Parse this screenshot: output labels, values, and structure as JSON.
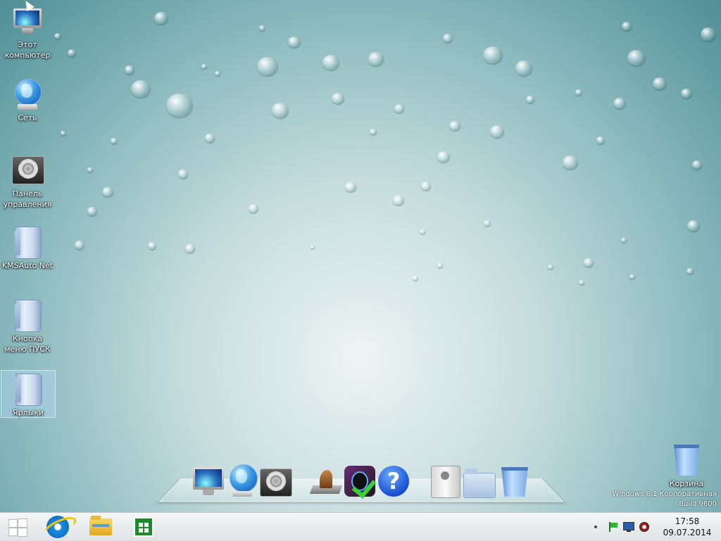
{
  "desktop": {
    "icons": [
      {
        "label": "Этот компьютер",
        "icon": "monitor-icon"
      },
      {
        "label": "Сеть",
        "icon": "globe-network-icon"
      },
      {
        "label": "Панель управления",
        "icon": "control-panel-gear-icon"
      },
      {
        "label": "KMSAuto Net",
        "icon": "folder-icon"
      },
      {
        "label": "Кнопка меню ПУСК",
        "icon": "folder-icon"
      },
      {
        "label": "Ярлыки",
        "icon": "folder-icon"
      }
    ],
    "recycle_bin": {
      "label": "Корзина",
      "icon": "recycle-bin-icon"
    },
    "watermark": {
      "line1": "Windows 8.1 Корпоративная",
      "line2": "Build 9600"
    }
  },
  "dock": {
    "items": [
      "monitor-icon",
      "globe-network-icon",
      "system-preferences-gear-icon",
      "chess-knight-icon",
      "apple-checkmark-icon",
      "help-question-icon",
      "hard-drive-icon",
      "documents-folder-icon",
      "recycle-bin-icon"
    ]
  },
  "taskbar": {
    "buttons": [
      "windows-start-icon",
      "internet-explorer-icon",
      "file-explorer-icon",
      "windows-store-icon"
    ],
    "tray": [
      "show-hidden-dot-icon",
      "action-center-flag-icon",
      "network-monitor-icon",
      "speaker-icon"
    ],
    "clock": {
      "time": "17:58",
      "date": "09.07.2014"
    }
  },
  "colors": {
    "accent_blue": "#1e88e5",
    "store_green": "#1b8a2a",
    "ie_blue": "#1a8fe3",
    "folder_yellow": "#f2c23a"
  }
}
